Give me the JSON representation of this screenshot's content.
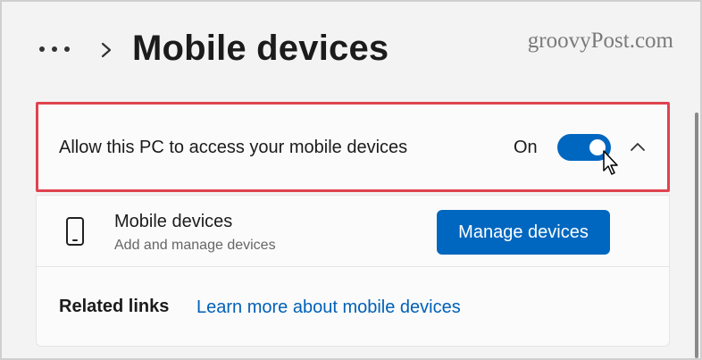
{
  "header": {
    "title": "Mobile devices",
    "watermark": "groovyPost.com"
  },
  "setting": {
    "label": "Allow this PC to access your mobile devices",
    "toggle_state": "On",
    "toggle_on": true
  },
  "mobile_devices": {
    "title": "Mobile devices",
    "subtitle": "Add and manage devices",
    "manage_button": "Manage devices"
  },
  "related": {
    "label": "Related links",
    "link": "Learn more about mobile devices"
  },
  "icons": {
    "more": "more-dots-icon",
    "breadcrumb": "chevron-right-icon",
    "collapse": "chevron-up-icon",
    "device": "phone-icon",
    "cursor": "mouse-cursor-icon"
  },
  "colors": {
    "accent": "#0067c0",
    "highlight": "#e0434f",
    "link": "#0060b8"
  }
}
